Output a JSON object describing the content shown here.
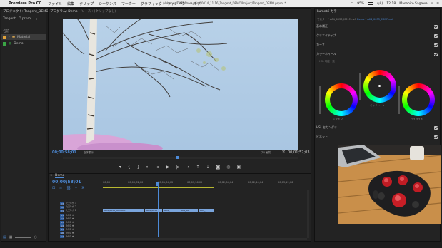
{
  "menubar": {
    "app_name": "Premiere Pro CC",
    "items": [
      "ファイル",
      "編集",
      "クリップ",
      "シーケンス",
      "マーカー",
      "グラフィック",
      "ウィンドウ",
      "ヘルプ"
    ],
    "path": "/Volumes/DATA/Production/0014_11.16_Tangent_DEMO/Project/Tangent_DEMO.prproj *",
    "battery": "95%",
    "day": "(火)",
    "time": "12:18",
    "user": "Masahiro Sagawa"
  },
  "project": {
    "tab": "プロジェクト: Tangent_DEMO",
    "file": "Tangent...O.prproj",
    "column_header": "名前",
    "items": [
      {
        "label": "Material",
        "color": "#e0a23a"
      },
      {
        "label": "Demo",
        "color": "#3aa545"
      }
    ]
  },
  "program": {
    "tab_active": "プログラム: Demo",
    "tab_other": "ソース : (クリップなし)",
    "timecode_left": "00;00;58;01",
    "fit": "全体表示",
    "quality": "フル画質",
    "timecode_right": "00;01;57;03"
  },
  "timeline": {
    "tab": "Demo",
    "timecode": "00;00;58;01",
    "ruler": [
      "00;00",
      "00;00;32;00",
      "00;01;04;02",
      "00;01;36;02",
      "00;02;08;04",
      "00;02;40;04",
      "00;03;12;06"
    ],
    "tracks": [
      {
        "id": "V3",
        "name": "ビデオ 3"
      },
      {
        "id": "V2",
        "name": "ビデオ 2"
      },
      {
        "id": "V1",
        "name": "ビデオ 1"
      },
      {
        "id": "A1",
        "name": ""
      },
      {
        "id": "A2",
        "name": ""
      },
      {
        "id": "A3",
        "name": ""
      },
      {
        "id": "A4",
        "name": ""
      },
      {
        "id": "A5",
        "name": ""
      },
      {
        "id": "A6",
        "name": ""
      },
      {
        "id": "A7",
        "name": ""
      }
    ],
    "clips": [
      "A04_0033_M01.MXF",
      "A04_0033",
      "A04_",
      "A04_00",
      "A04_"
    ]
  },
  "lumetri": {
    "tab": "Lumetri カラー",
    "breadcrumb_master": "マスター * A04_0033_M01F.mxf",
    "breadcrumb_seq": "Demo * A04_0033_M01F.mxf",
    "sections": [
      "基本補正",
      "クリエイティブ",
      "カーブ",
      "カラーホイール"
    ],
    "hsl_label": "HSL 明度一致",
    "wheels": [
      "シャドウ",
      "ミッドトーン",
      "ハイライト"
    ],
    "hsl_secondary": "HSL セカンダリ",
    "vignette": "ビネット"
  },
  "colors": {
    "accent": "#4d8bd8",
    "playhead": "#4d8bd8",
    "clip": "#7aa5dd"
  }
}
